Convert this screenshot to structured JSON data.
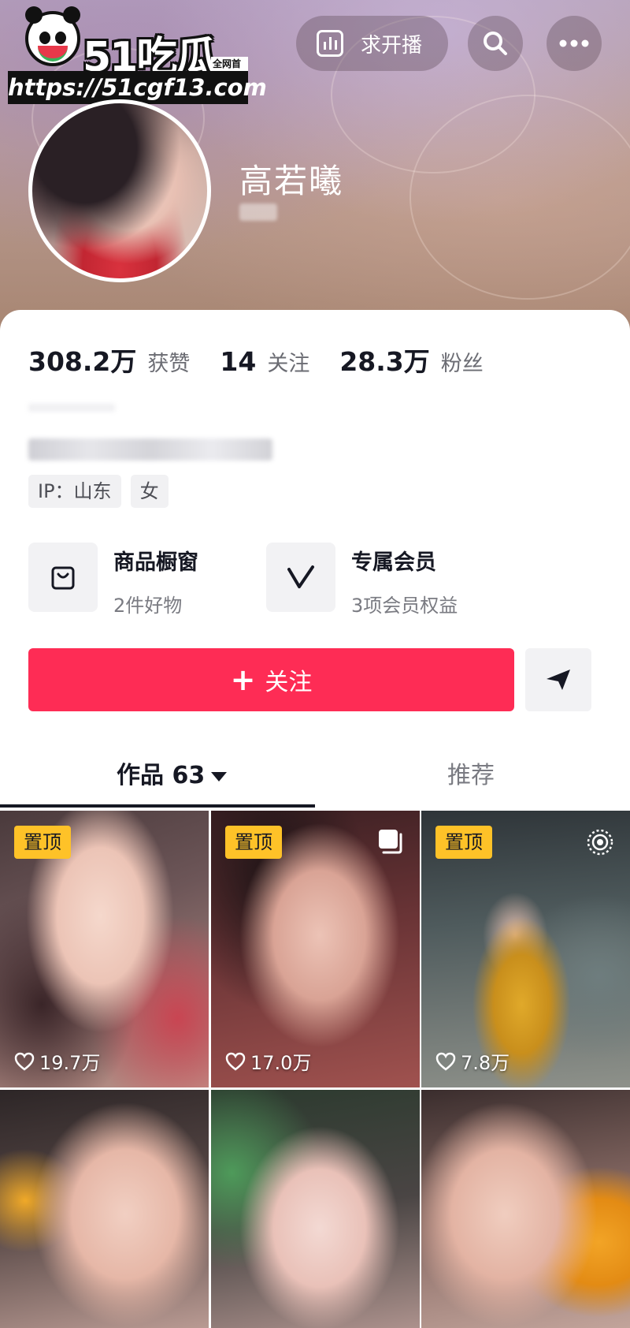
{
  "watermark": {
    "brand": "51吃瓜",
    "tag": "全网首发",
    "url": "https://51cgf13.com"
  },
  "header": {
    "live_request_label": "求开播",
    "icons": [
      "bar-chart-icon",
      "search-icon",
      "more-icon"
    ]
  },
  "profile": {
    "name": "高若曦"
  },
  "stats": [
    {
      "value": "308.2万",
      "label": "获赞"
    },
    {
      "value": "14",
      "label": "关注"
    },
    {
      "value": "28.3万",
      "label": "粉丝"
    }
  ],
  "tags": [
    "IP：山东",
    "女"
  ],
  "features": [
    {
      "title": "商品橱窗",
      "subtitle": "2件好物",
      "icon": "shopping-bag-icon"
    },
    {
      "title": "专属会员",
      "subtitle": "3项会员权益",
      "icon": "member-v-icon"
    }
  ],
  "actions": {
    "follow_label": "关注",
    "share_icon": "send-icon"
  },
  "tabs": {
    "works": "作品 63",
    "recommend": "推荐"
  },
  "grid": {
    "pin_label": "置顶",
    "items": [
      {
        "pinned": true,
        "likes": "19.7万"
      },
      {
        "pinned": true,
        "likes": "17.0万"
      },
      {
        "pinned": true,
        "likes": "7.8万"
      },
      {
        "pinned": false,
        "likes": ""
      },
      {
        "pinned": false,
        "likes": ""
      },
      {
        "pinned": false,
        "likes": ""
      }
    ]
  },
  "colors": {
    "accent": "#fe2c55",
    "pin": "#fec228",
    "text_primary": "#161823",
    "text_secondary": "#6b6c73"
  }
}
